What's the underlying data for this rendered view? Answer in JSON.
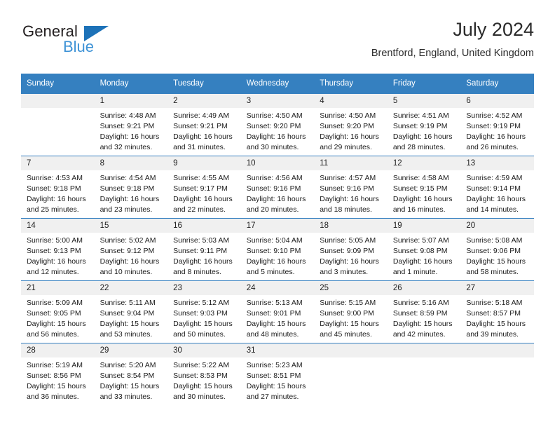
{
  "brand": {
    "name_part1": "General",
    "name_part2": "Blue",
    "accent_color": "#1d72b8",
    "accent_color_light": "#3d92d6"
  },
  "header": {
    "title": "July 2024",
    "subtitle": "Brentford, England, United Kingdom"
  },
  "calendar": {
    "header_color": "#3580c0",
    "daynum_band_color": "#f0f0f0",
    "weekday_names": [
      "Sunday",
      "Monday",
      "Tuesday",
      "Wednesday",
      "Thursday",
      "Friday",
      "Saturday"
    ],
    "weeks": [
      [
        {
          "day": "",
          "sunrise": "",
          "sunset": "",
          "daylight1": "",
          "daylight2": ""
        },
        {
          "day": "1",
          "sunrise": "Sunrise: 4:48 AM",
          "sunset": "Sunset: 9:21 PM",
          "daylight1": "Daylight: 16 hours",
          "daylight2": "and 32 minutes."
        },
        {
          "day": "2",
          "sunrise": "Sunrise: 4:49 AM",
          "sunset": "Sunset: 9:21 PM",
          "daylight1": "Daylight: 16 hours",
          "daylight2": "and 31 minutes."
        },
        {
          "day": "3",
          "sunrise": "Sunrise: 4:50 AM",
          "sunset": "Sunset: 9:20 PM",
          "daylight1": "Daylight: 16 hours",
          "daylight2": "and 30 minutes."
        },
        {
          "day": "4",
          "sunrise": "Sunrise: 4:50 AM",
          "sunset": "Sunset: 9:20 PM",
          "daylight1": "Daylight: 16 hours",
          "daylight2": "and 29 minutes."
        },
        {
          "day": "5",
          "sunrise": "Sunrise: 4:51 AM",
          "sunset": "Sunset: 9:19 PM",
          "daylight1": "Daylight: 16 hours",
          "daylight2": "and 28 minutes."
        },
        {
          "day": "6",
          "sunrise": "Sunrise: 4:52 AM",
          "sunset": "Sunset: 9:19 PM",
          "daylight1": "Daylight: 16 hours",
          "daylight2": "and 26 minutes."
        }
      ],
      [
        {
          "day": "7",
          "sunrise": "Sunrise: 4:53 AM",
          "sunset": "Sunset: 9:18 PM",
          "daylight1": "Daylight: 16 hours",
          "daylight2": "and 25 minutes."
        },
        {
          "day": "8",
          "sunrise": "Sunrise: 4:54 AM",
          "sunset": "Sunset: 9:18 PM",
          "daylight1": "Daylight: 16 hours",
          "daylight2": "and 23 minutes."
        },
        {
          "day": "9",
          "sunrise": "Sunrise: 4:55 AM",
          "sunset": "Sunset: 9:17 PM",
          "daylight1": "Daylight: 16 hours",
          "daylight2": "and 22 minutes."
        },
        {
          "day": "10",
          "sunrise": "Sunrise: 4:56 AM",
          "sunset": "Sunset: 9:16 PM",
          "daylight1": "Daylight: 16 hours",
          "daylight2": "and 20 minutes."
        },
        {
          "day": "11",
          "sunrise": "Sunrise: 4:57 AM",
          "sunset": "Sunset: 9:16 PM",
          "daylight1": "Daylight: 16 hours",
          "daylight2": "and 18 minutes."
        },
        {
          "day": "12",
          "sunrise": "Sunrise: 4:58 AM",
          "sunset": "Sunset: 9:15 PM",
          "daylight1": "Daylight: 16 hours",
          "daylight2": "and 16 minutes."
        },
        {
          "day": "13",
          "sunrise": "Sunrise: 4:59 AM",
          "sunset": "Sunset: 9:14 PM",
          "daylight1": "Daylight: 16 hours",
          "daylight2": "and 14 minutes."
        }
      ],
      [
        {
          "day": "14",
          "sunrise": "Sunrise: 5:00 AM",
          "sunset": "Sunset: 9:13 PM",
          "daylight1": "Daylight: 16 hours",
          "daylight2": "and 12 minutes."
        },
        {
          "day": "15",
          "sunrise": "Sunrise: 5:02 AM",
          "sunset": "Sunset: 9:12 PM",
          "daylight1": "Daylight: 16 hours",
          "daylight2": "and 10 minutes."
        },
        {
          "day": "16",
          "sunrise": "Sunrise: 5:03 AM",
          "sunset": "Sunset: 9:11 PM",
          "daylight1": "Daylight: 16 hours",
          "daylight2": "and 8 minutes."
        },
        {
          "day": "17",
          "sunrise": "Sunrise: 5:04 AM",
          "sunset": "Sunset: 9:10 PM",
          "daylight1": "Daylight: 16 hours",
          "daylight2": "and 5 minutes."
        },
        {
          "day": "18",
          "sunrise": "Sunrise: 5:05 AM",
          "sunset": "Sunset: 9:09 PM",
          "daylight1": "Daylight: 16 hours",
          "daylight2": "and 3 minutes."
        },
        {
          "day": "19",
          "sunrise": "Sunrise: 5:07 AM",
          "sunset": "Sunset: 9:08 PM",
          "daylight1": "Daylight: 16 hours",
          "daylight2": "and 1 minute."
        },
        {
          "day": "20",
          "sunrise": "Sunrise: 5:08 AM",
          "sunset": "Sunset: 9:06 PM",
          "daylight1": "Daylight: 15 hours",
          "daylight2": "and 58 minutes."
        }
      ],
      [
        {
          "day": "21",
          "sunrise": "Sunrise: 5:09 AM",
          "sunset": "Sunset: 9:05 PM",
          "daylight1": "Daylight: 15 hours",
          "daylight2": "and 56 minutes."
        },
        {
          "day": "22",
          "sunrise": "Sunrise: 5:11 AM",
          "sunset": "Sunset: 9:04 PM",
          "daylight1": "Daylight: 15 hours",
          "daylight2": "and 53 minutes."
        },
        {
          "day": "23",
          "sunrise": "Sunrise: 5:12 AM",
          "sunset": "Sunset: 9:03 PM",
          "daylight1": "Daylight: 15 hours",
          "daylight2": "and 50 minutes."
        },
        {
          "day": "24",
          "sunrise": "Sunrise: 5:13 AM",
          "sunset": "Sunset: 9:01 PM",
          "daylight1": "Daylight: 15 hours",
          "daylight2": "and 48 minutes."
        },
        {
          "day": "25",
          "sunrise": "Sunrise: 5:15 AM",
          "sunset": "Sunset: 9:00 PM",
          "daylight1": "Daylight: 15 hours",
          "daylight2": "and 45 minutes."
        },
        {
          "day": "26",
          "sunrise": "Sunrise: 5:16 AM",
          "sunset": "Sunset: 8:59 PM",
          "daylight1": "Daylight: 15 hours",
          "daylight2": "and 42 minutes."
        },
        {
          "day": "27",
          "sunrise": "Sunrise: 5:18 AM",
          "sunset": "Sunset: 8:57 PM",
          "daylight1": "Daylight: 15 hours",
          "daylight2": "and 39 minutes."
        }
      ],
      [
        {
          "day": "28",
          "sunrise": "Sunrise: 5:19 AM",
          "sunset": "Sunset: 8:56 PM",
          "daylight1": "Daylight: 15 hours",
          "daylight2": "and 36 minutes."
        },
        {
          "day": "29",
          "sunrise": "Sunrise: 5:20 AM",
          "sunset": "Sunset: 8:54 PM",
          "daylight1": "Daylight: 15 hours",
          "daylight2": "and 33 minutes."
        },
        {
          "day": "30",
          "sunrise": "Sunrise: 5:22 AM",
          "sunset": "Sunset: 8:53 PM",
          "daylight1": "Daylight: 15 hours",
          "daylight2": "and 30 minutes."
        },
        {
          "day": "31",
          "sunrise": "Sunrise: 5:23 AM",
          "sunset": "Sunset: 8:51 PM",
          "daylight1": "Daylight: 15 hours",
          "daylight2": "and 27 minutes."
        },
        {
          "day": "",
          "sunrise": "",
          "sunset": "",
          "daylight1": "",
          "daylight2": ""
        },
        {
          "day": "",
          "sunrise": "",
          "sunset": "",
          "daylight1": "",
          "daylight2": ""
        },
        {
          "day": "",
          "sunrise": "",
          "sunset": "",
          "daylight1": "",
          "daylight2": ""
        }
      ]
    ]
  }
}
